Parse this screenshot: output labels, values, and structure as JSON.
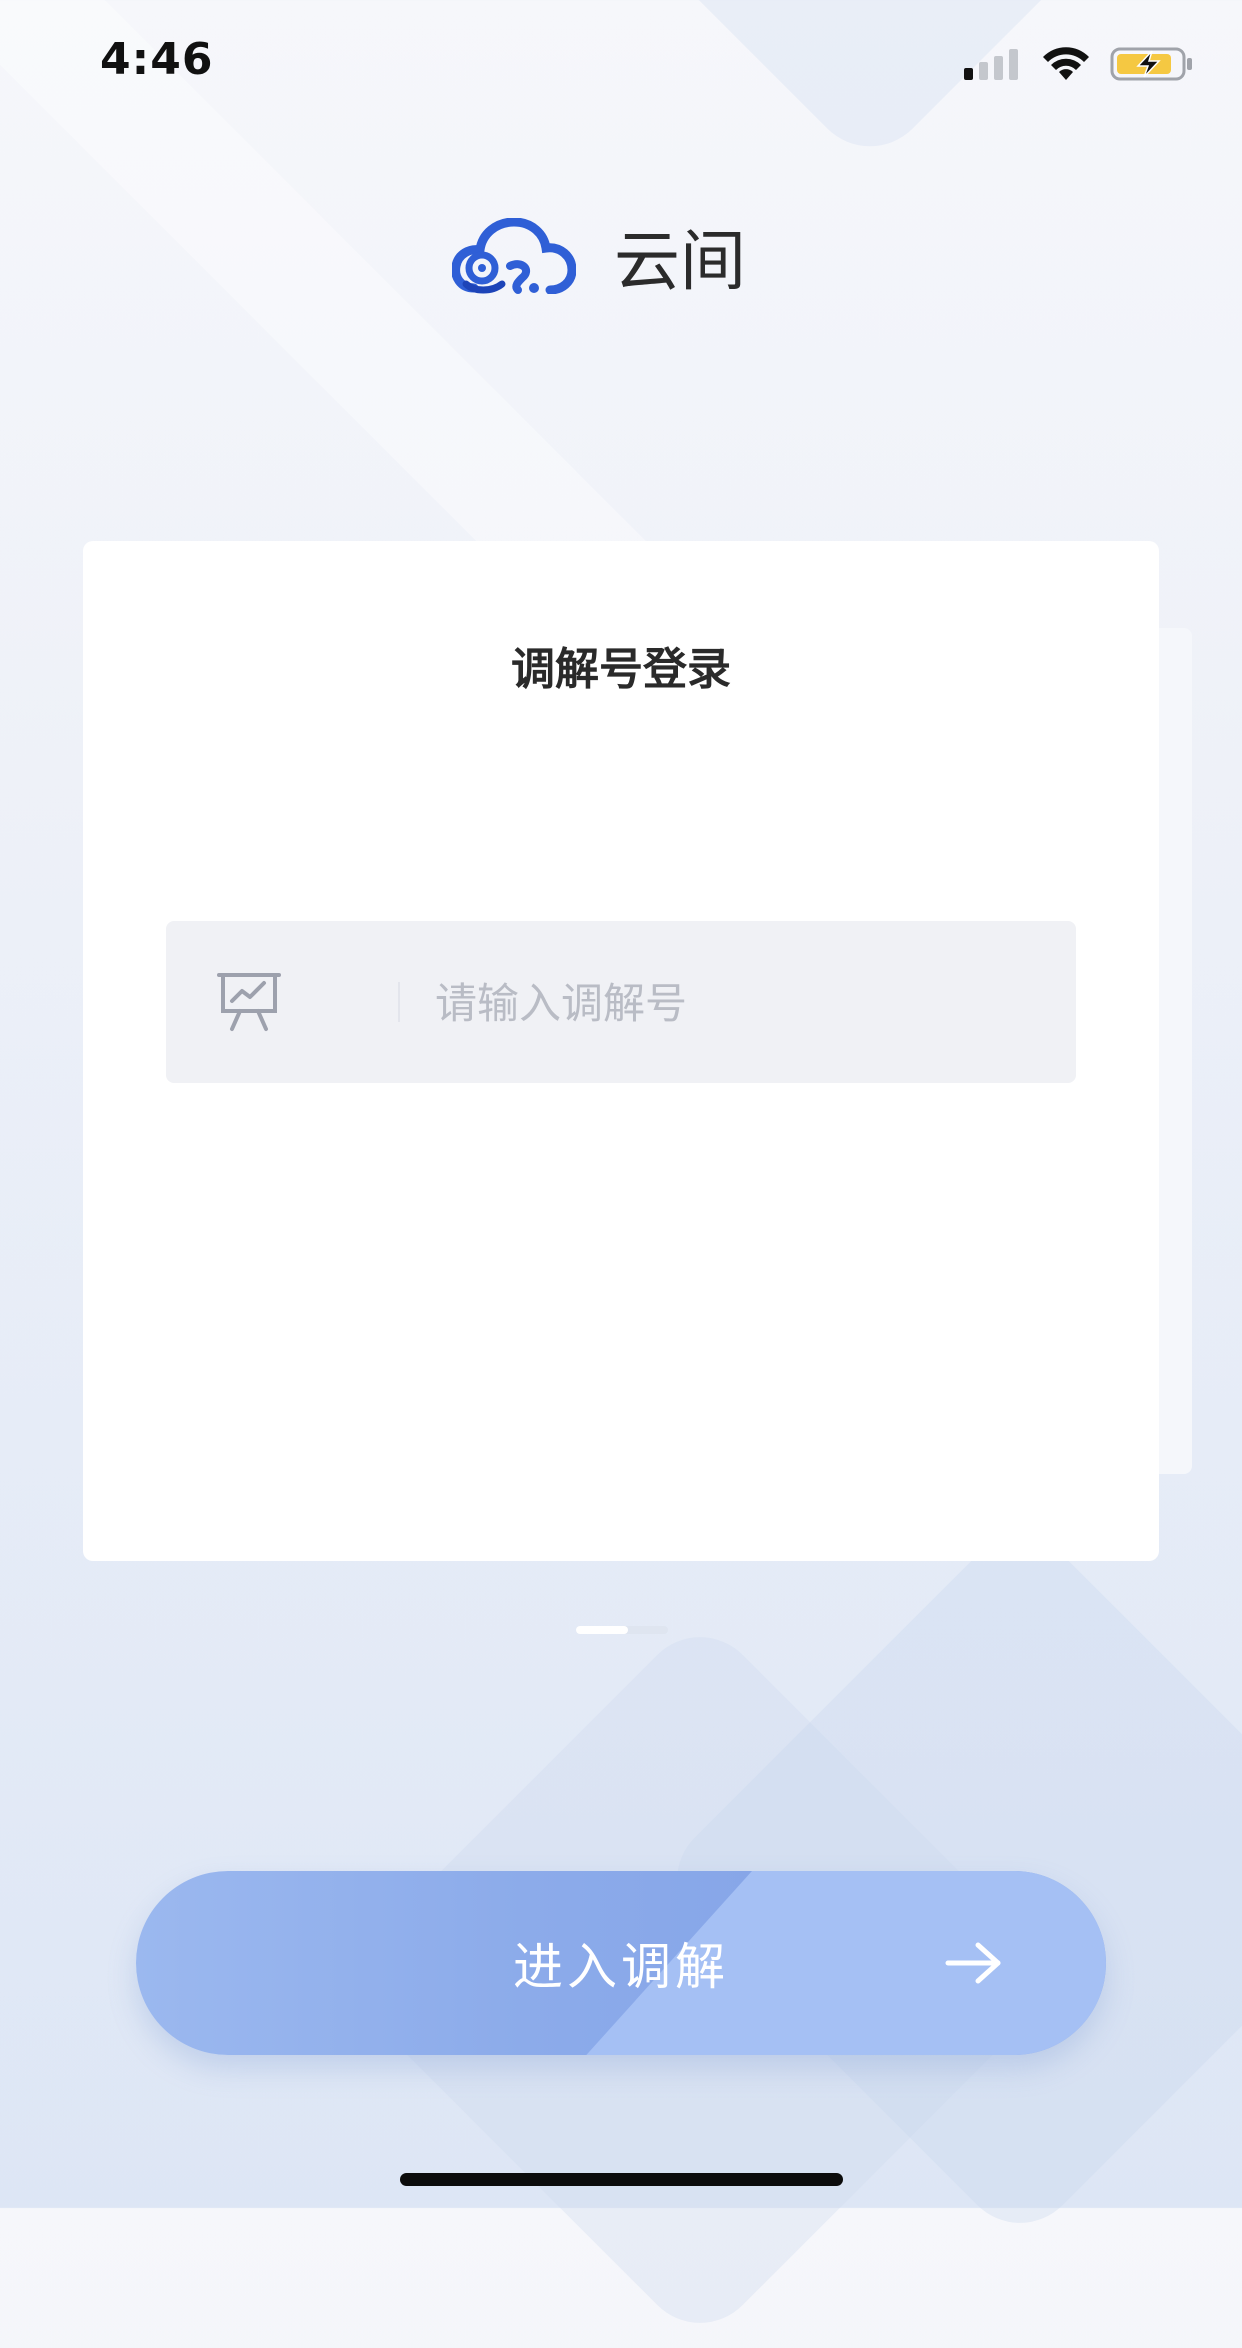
{
  "status_bar": {
    "time": "4:46",
    "icons": [
      "cellular-signal-icon",
      "wifi-icon",
      "battery-charging-icon"
    ]
  },
  "brand": {
    "logo_icon": "cloud-logo-icon",
    "name": "云间",
    "accent_color": "#2f5fd6"
  },
  "login_card": {
    "title": "调解号登录",
    "input": {
      "icon": "presentation-board-icon",
      "placeholder": "请输入调解号",
      "value": ""
    }
  },
  "page_indicator": {
    "icon": "page-indicator"
  },
  "enter_button": {
    "label": "进入调解",
    "icon": "arrow-right-icon"
  }
}
